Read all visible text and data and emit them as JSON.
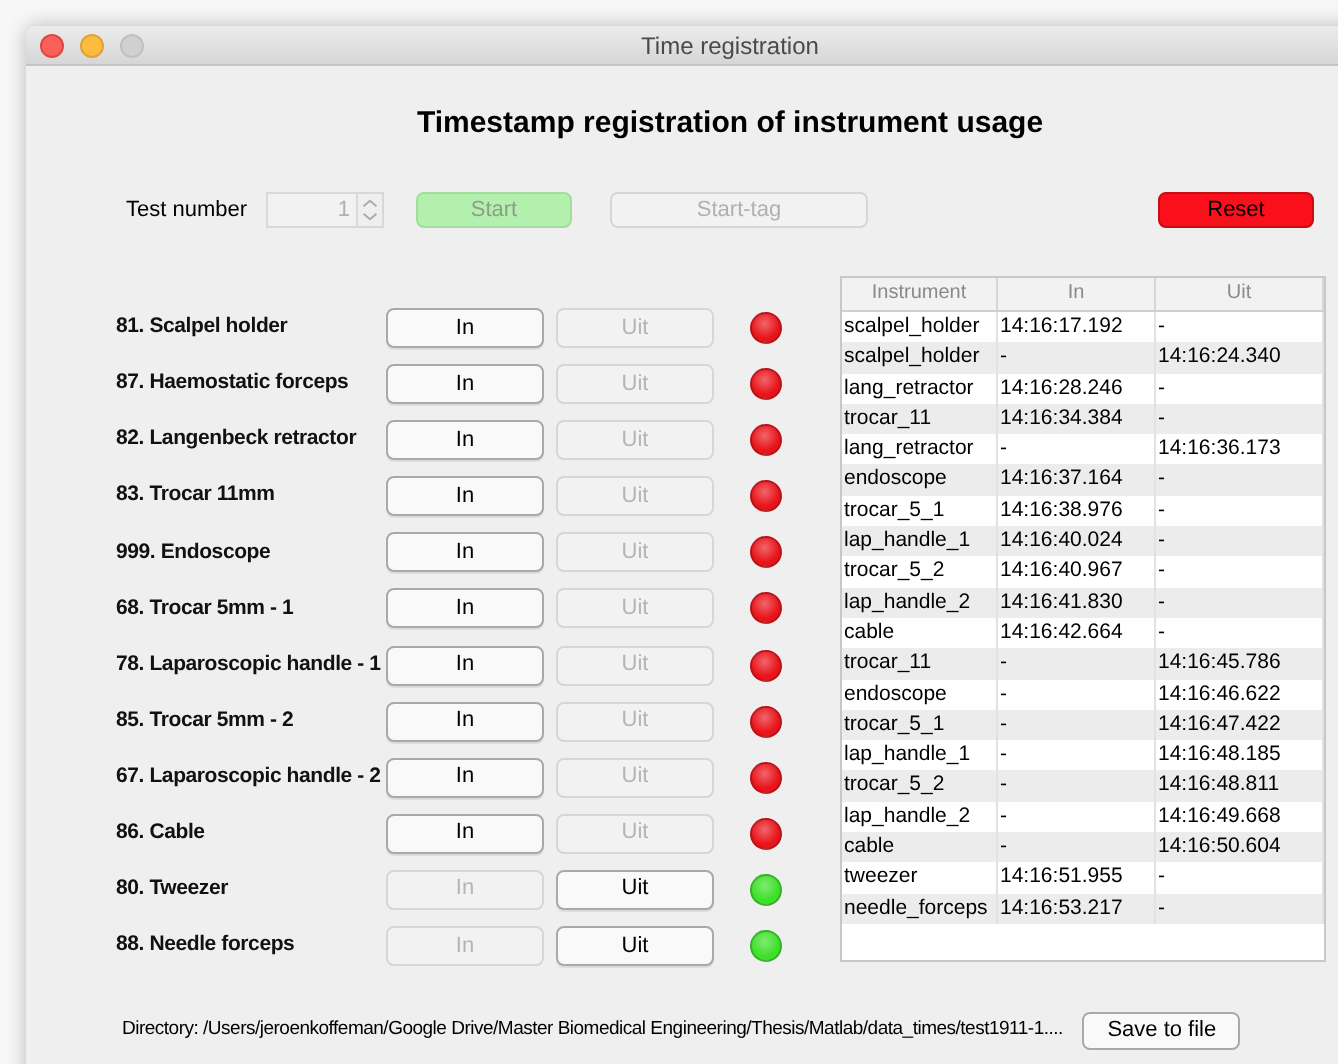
{
  "window": {
    "title": "Time registration"
  },
  "heading": "Timestamp registration of instrument usage",
  "controls": {
    "test_number_label": "Test number",
    "test_number": {
      "value": "1",
      "disabled": true
    },
    "start": {
      "label": "Start",
      "disabled": true
    },
    "start_tag": {
      "label": "Start-tag",
      "disabled": true
    },
    "reset": {
      "label": "Reset",
      "disabled": false
    }
  },
  "instruments": [
    {
      "label": "81. Scalpel holder",
      "in": {
        "label": "In",
        "disabled": false
      },
      "uit": {
        "label": "Uit",
        "disabled": true
      },
      "color": "#e8141b"
    },
    {
      "label": "87. Haemostatic forceps",
      "in": {
        "label": "In",
        "disabled": false
      },
      "uit": {
        "label": "Uit",
        "disabled": true
      },
      "color": "#e8141b"
    },
    {
      "label": "82. Langenbeck retractor",
      "in": {
        "label": "In",
        "disabled": false
      },
      "uit": {
        "label": "Uit",
        "disabled": true
      },
      "color": "#e8141b"
    },
    {
      "label": "83. Trocar 11mm",
      "in": {
        "label": "In",
        "disabled": false
      },
      "uit": {
        "label": "Uit",
        "disabled": true
      },
      "color": "#e8141b"
    },
    {
      "label": "999. Endoscope",
      "in": {
        "label": "In",
        "disabled": false
      },
      "uit": {
        "label": "Uit",
        "disabled": true
      },
      "color": "#e8141b"
    },
    {
      "label": "68. Trocar 5mm - 1",
      "in": {
        "label": "In",
        "disabled": false
      },
      "uit": {
        "label": "Uit",
        "disabled": true
      },
      "color": "#e8141b"
    },
    {
      "label": "78. Laparoscopic handle - 1",
      "in": {
        "label": "In",
        "disabled": false
      },
      "uit": {
        "label": "Uit",
        "disabled": true
      },
      "color": "#e8141b"
    },
    {
      "label": "85. Trocar 5mm - 2",
      "in": {
        "label": "In",
        "disabled": false
      },
      "uit": {
        "label": "Uit",
        "disabled": true
      },
      "color": "#e8141b"
    },
    {
      "label": "67. Laparoscopic handle - 2",
      "in": {
        "label": "In",
        "disabled": false
      },
      "uit": {
        "label": "Uit",
        "disabled": true
      },
      "color": "#e8141b"
    },
    {
      "label": "86. Cable",
      "in": {
        "label": "In",
        "disabled": false
      },
      "uit": {
        "label": "Uit",
        "disabled": true
      },
      "color": "#e8141b"
    },
    {
      "label": "80. Tweezer",
      "in": {
        "label": "In",
        "disabled": true
      },
      "uit": {
        "label": "Uit",
        "disabled": false
      },
      "color": "#3ee02a"
    },
    {
      "label": "88. Needle forceps",
      "in": {
        "label": "In",
        "disabled": true
      },
      "uit": {
        "label": "Uit",
        "disabled": false
      },
      "color": "#3ee02a"
    }
  ],
  "table": {
    "columns": [
      "Instrument",
      "In",
      "Uit"
    ],
    "rows": [
      [
        "scalpel_holder",
        "14:16:17.192",
        "-"
      ],
      [
        "scalpel_holder",
        "-",
        "14:16:24.340"
      ],
      [
        "lang_retractor",
        "14:16:28.246",
        "-"
      ],
      [
        "trocar_11",
        "14:16:34.384",
        "-"
      ],
      [
        "lang_retractor",
        "-",
        "14:16:36.173"
      ],
      [
        "endoscope",
        "14:16:37.164",
        "-"
      ],
      [
        "trocar_5_1",
        "14:16:38.976",
        "-"
      ],
      [
        "lap_handle_1",
        "14:16:40.024",
        "-"
      ],
      [
        "trocar_5_2",
        "14:16:40.967",
        "-"
      ],
      [
        "lap_handle_2",
        "14:16:41.830",
        "-"
      ],
      [
        "cable",
        "14:16:42.664",
        "-"
      ],
      [
        "trocar_11",
        "-",
        "14:16:45.786"
      ],
      [
        "endoscope",
        "-",
        "14:16:46.622"
      ],
      [
        "trocar_5_1",
        "-",
        "14:16:47.422"
      ],
      [
        "lap_handle_1",
        "-",
        "14:16:48.185"
      ],
      [
        "trocar_5_2",
        "-",
        "14:16:48.811"
      ],
      [
        "lap_handle_2",
        "-",
        "14:16:49.668"
      ],
      [
        "cable",
        "-",
        "14:16:50.604"
      ],
      [
        "tweezer",
        "14:16:51.955",
        "-"
      ],
      [
        "needle_forceps",
        "14:16:53.217",
        "-"
      ]
    ]
  },
  "directory": "Directory: /Users/jeroenkoffeman/Google Drive/Master Biomedical Engineering/Thesis/Matlab/data_times/test1911-1....",
  "save_button": "Save to file"
}
